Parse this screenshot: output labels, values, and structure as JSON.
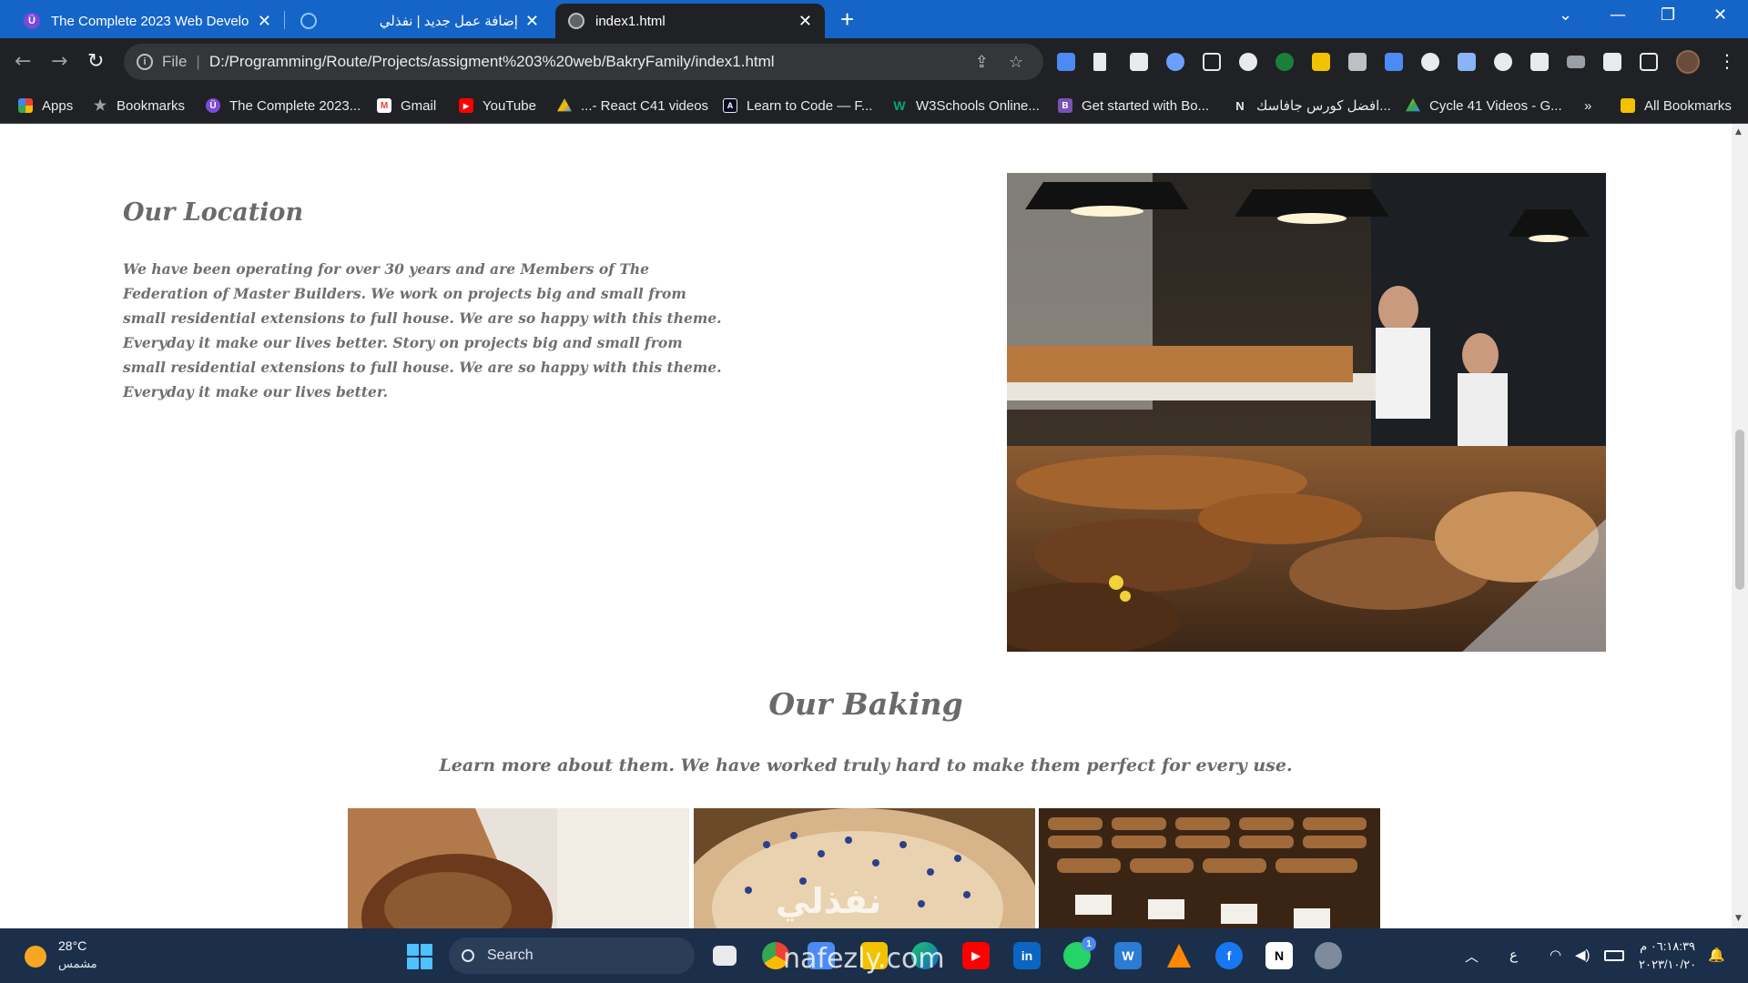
{
  "browser": {
    "tabs": [
      {
        "title": "The Complete 2023 Web Develo",
        "favicon_color": "#7b4bd8",
        "favicon_glyph": "Ü"
      },
      {
        "title": "إضافة عمل جديد | نفذلي",
        "favicon_color": "#1565c8",
        "favicon_glyph": ""
      },
      {
        "title": "index1.html",
        "favicon_color": "#5f6368",
        "favicon_glyph": ""
      }
    ],
    "address": {
      "scheme": "File",
      "url": "D:/Programming/Route/Projects/assigment%203%20web/BakryFamily/index1.html"
    },
    "bookmarks": [
      {
        "label": "Apps",
        "icon": "apps-grid-icon",
        "color": "#e8453c"
      },
      {
        "label": "Bookmarks",
        "icon": "star-icon",
        "color": "#9aa0a6"
      },
      {
        "label": "The Complete 2023...",
        "icon": "udemy-icon",
        "color": "#7b4bd8"
      },
      {
        "label": "Gmail",
        "icon": "gmail-icon",
        "color": "#ea4335"
      },
      {
        "label": "YouTube",
        "icon": "youtube-icon",
        "color": "#ff0000"
      },
      {
        "label": "...- React C41 videos",
        "icon": "drive-icon",
        "color": "#34a853"
      },
      {
        "label": "Learn to Code — F...",
        "icon": "freecodecamp-icon",
        "color": "#0a0a23"
      },
      {
        "label": "W3Schools Online...",
        "icon": "w3schools-icon",
        "color": "#04aa6d"
      },
      {
        "label": "Get started with Bo...",
        "icon": "bootstrap-icon",
        "color": "#7952b3"
      },
      {
        "label": "افضل كورس جافاسك...",
        "icon": "notion-icon",
        "color": "#202124"
      },
      {
        "label": "Cycle 41 Videos - G...",
        "icon": "drive-icon",
        "color": "#fbbc04"
      }
    ],
    "overflow": "»",
    "all_bookmarks": "All Bookmarks"
  },
  "page": {
    "location": {
      "title": "Our Location",
      "text": "We have been operating for over 30 years and are Members of The Federation of Master Builders. We work on projects big and small from small residential extensions to full house. We are so happy with this theme. Everyday it make our lives better. Story on projects big and small from small residential extensions to full house. We are so happy with this theme. Everyday it make our lives better."
    },
    "baking": {
      "title": "Our Baking",
      "subtitle": "Learn more about them. We have worked truly hard to make them perfect for every use."
    }
  },
  "taskbar": {
    "temperature": "28°C",
    "condition": "مشمس",
    "search_label": "Search",
    "language": "ع",
    "time": "٠٦:١٨:٣٩ م",
    "date": "٢٠٢٣/١٠/٢٠",
    "whatsapp_badge": "1"
  },
  "watermark": {
    "arabic": "نفذلي",
    "latin": "nafezly.com"
  }
}
